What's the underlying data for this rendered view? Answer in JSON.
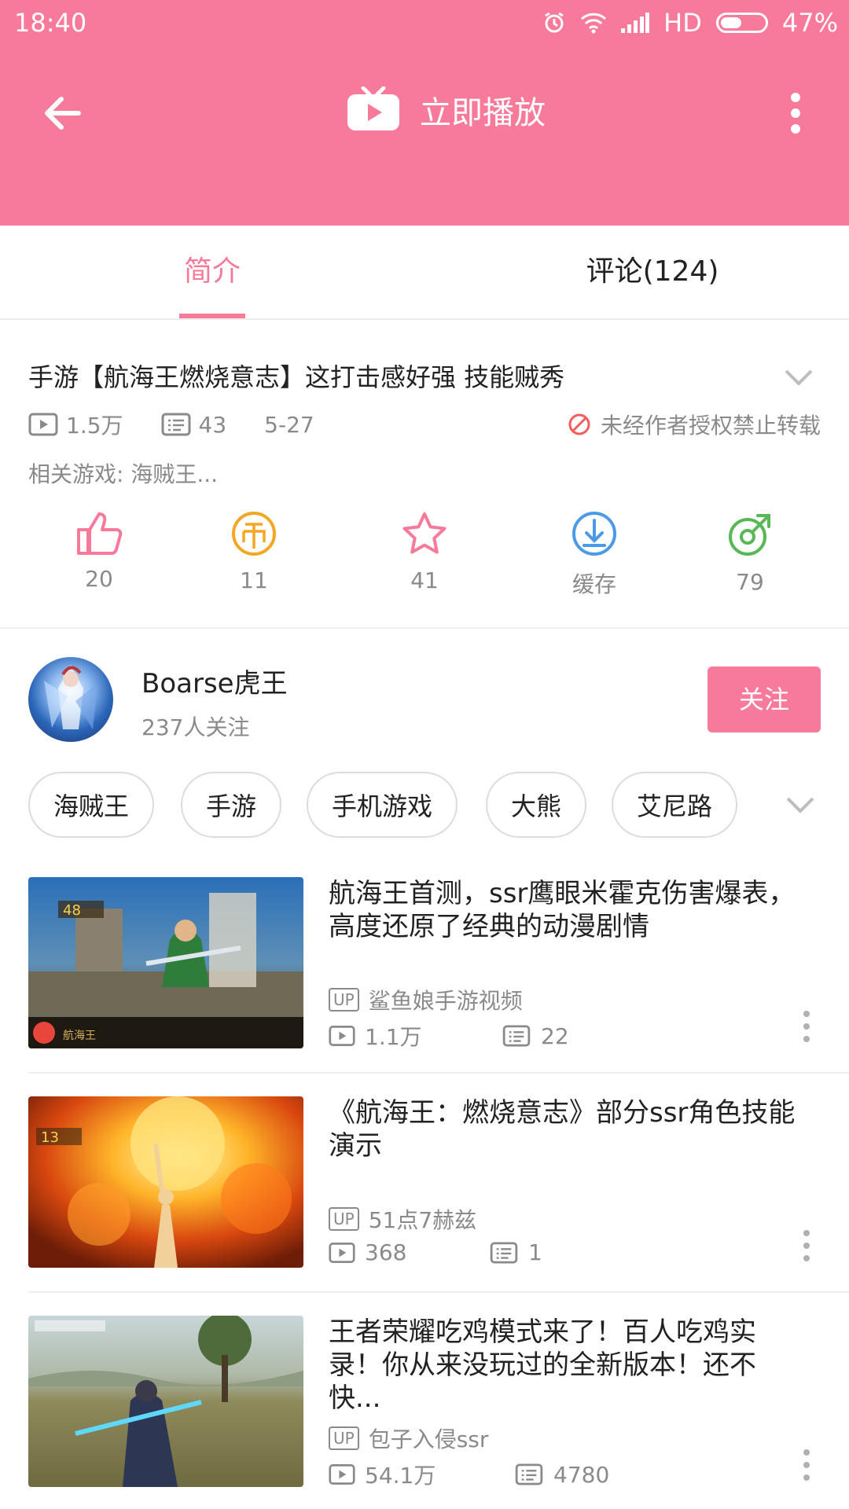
{
  "status_bar": {
    "time": "18:40",
    "network": "HD",
    "battery": "47%"
  },
  "header": {
    "title": "立即播放"
  },
  "tabs": [
    {
      "label": "简介"
    },
    {
      "label": "评论(124)"
    }
  ],
  "video": {
    "title": "手游【航海王燃烧意志】这打击感好强 技能贼秀",
    "views": "1.5万",
    "danmaku": "43",
    "date": "5-27",
    "copyright_notice": "未经作者授权禁止转载",
    "related_game": "相关游戏: 海贼王..."
  },
  "actions": [
    {
      "label": "20",
      "icon": "like-icon",
      "color": "#f77a9b"
    },
    {
      "label": "11",
      "icon": "coin-icon",
      "color": "#f5a623"
    },
    {
      "label": "41",
      "icon": "star-icon",
      "color": "#f77a9b"
    },
    {
      "label": "缓存",
      "icon": "download-icon",
      "color": "#4a9ae8"
    },
    {
      "label": "79",
      "icon": "share-icon",
      "color": "#58b856"
    }
  ],
  "uploader": {
    "name": "Boarse虎王",
    "followers": "237人关注",
    "follow_label": "关注"
  },
  "tags": [
    "海贼王",
    "手游",
    "手机游戏",
    "大熊",
    "艾尼路"
  ],
  "related": [
    {
      "title": "航海王首测，ssr鹰眼米霍克伤害爆表，高度还原了经典的动漫剧情",
      "up_badge": "UP",
      "uploader": "鲨鱼娘手游视频",
      "views": "1.1万",
      "danmaku": "22"
    },
    {
      "title": "《航海王：燃烧意志》部分ssr角色技能演示",
      "up_badge": "UP",
      "uploader": "51点7赫兹",
      "views": "368",
      "danmaku": "1"
    },
    {
      "title": "王者荣耀吃鸡模式来了！百人吃鸡实录！你从来没玩过的全新版本！还不快...",
      "up_badge": "UP",
      "uploader": "包子入侵ssr",
      "views": "54.1万",
      "danmaku": "4780"
    }
  ]
}
